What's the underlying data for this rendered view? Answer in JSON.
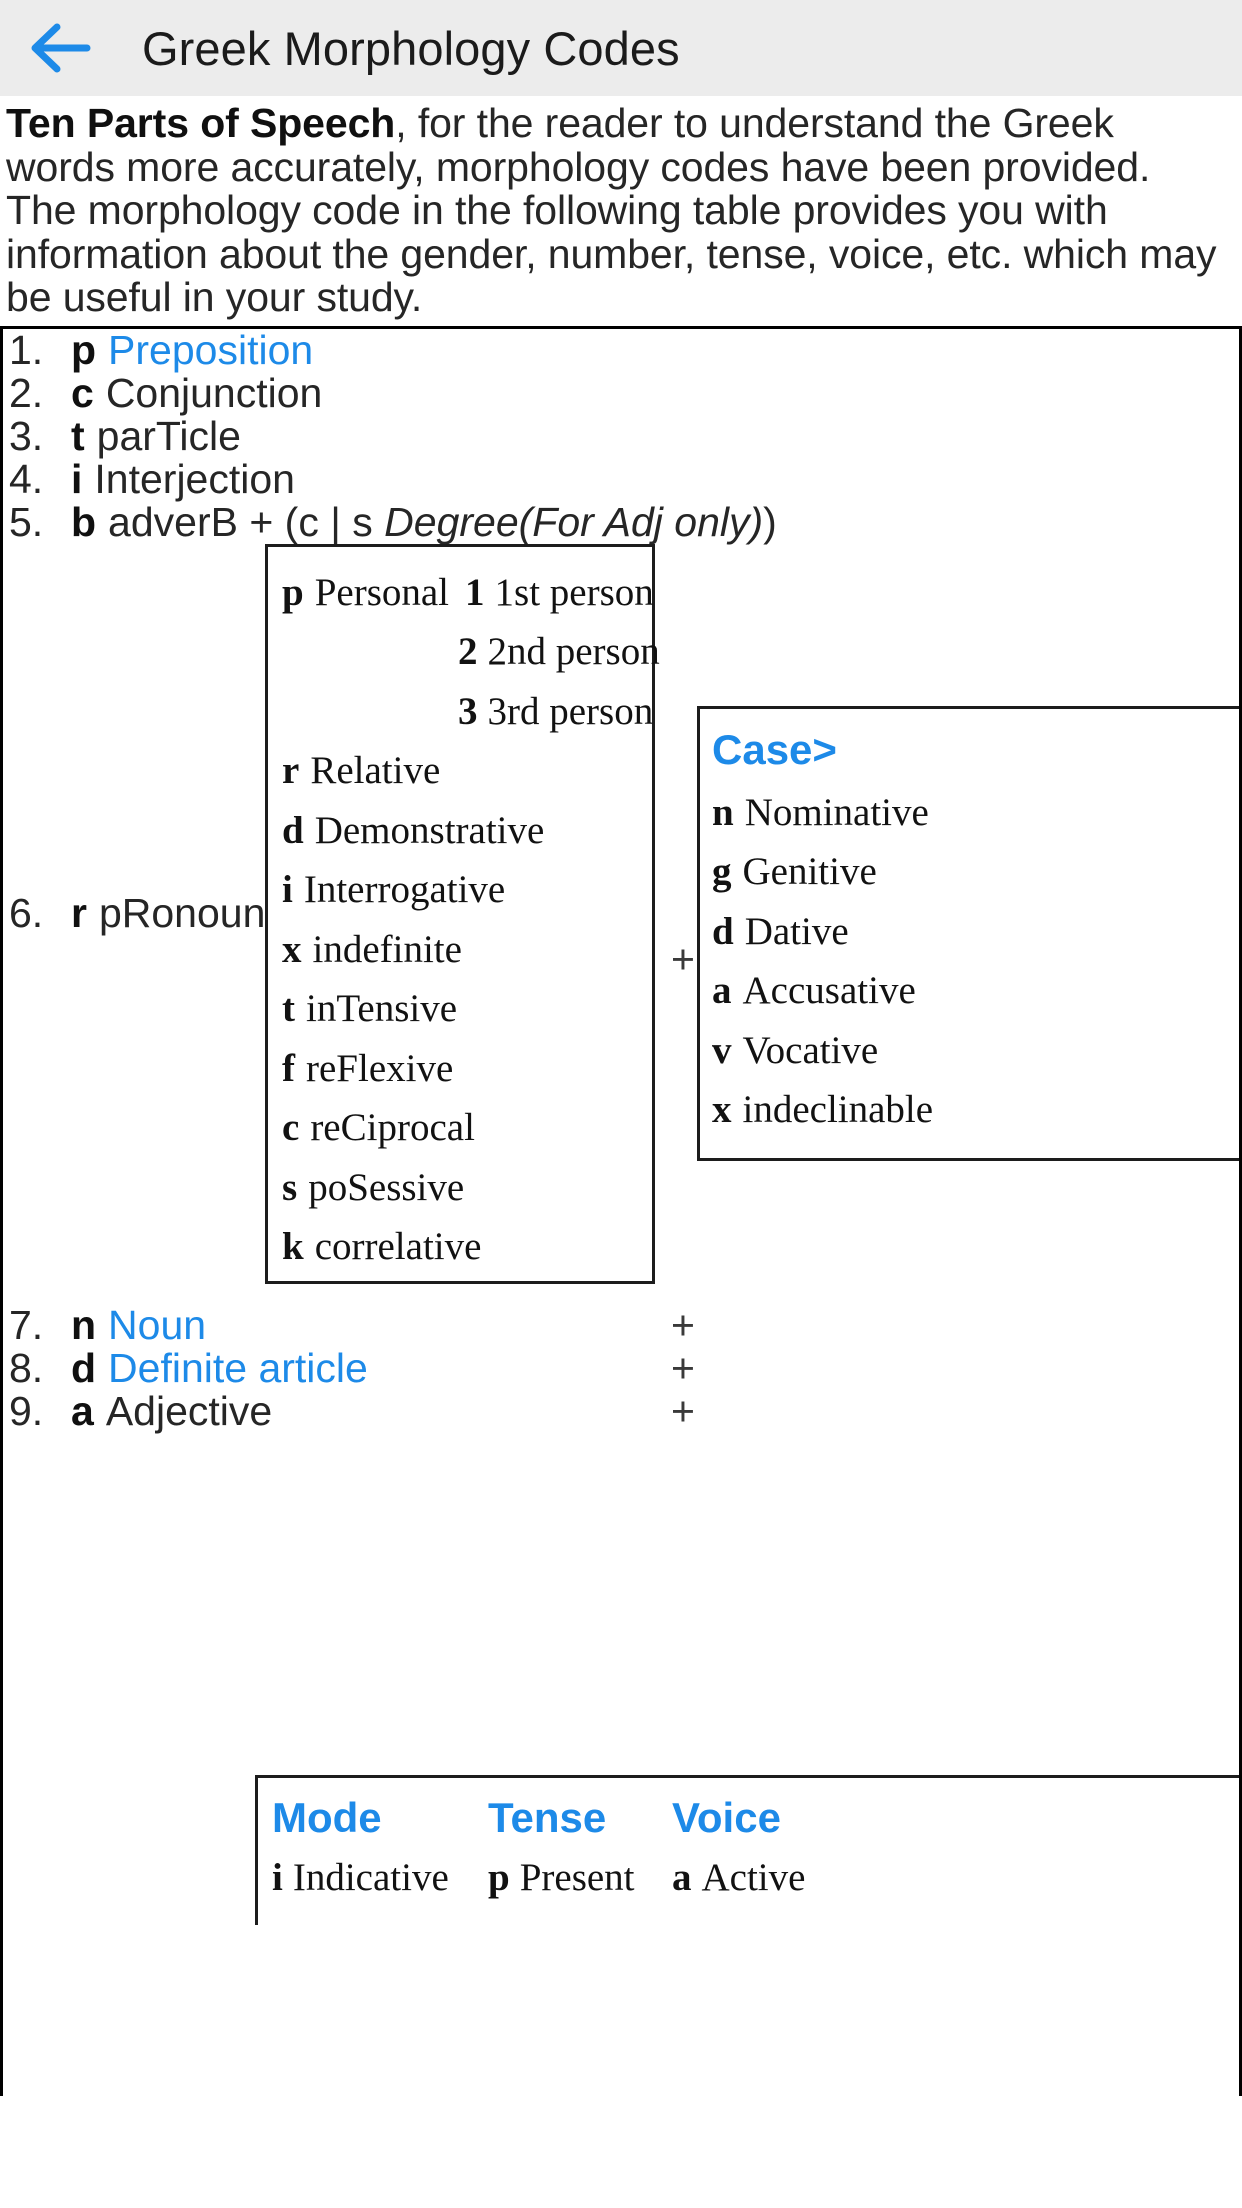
{
  "appbar": {
    "back_icon": "arrow-left-icon",
    "title": "Greek Morphology Codes",
    "accent": "#1d8ae8",
    "background": "#ececec"
  },
  "intro": {
    "lead": "Ten Parts of Speech",
    "body": ", for the reader to understand the Greek words more accurately, morphology codes have been provided. The morphology code in the following table provides you with information about the gender, number, tense, voice, etc. which may be useful in your study."
  },
  "parts_of_speech": [
    {
      "num": "1.",
      "code": "p",
      "label": "Preposition",
      "blue": true
    },
    {
      "num": "2.",
      "code": "c",
      "label": "Conjunction",
      "blue": false
    },
    {
      "num": "3.",
      "code": "t",
      "label": "parTicle",
      "blue": false
    },
    {
      "num": "4.",
      "code": "i",
      "label": "Interjection",
      "blue": false
    },
    {
      "num": "5.",
      "code": "b",
      "label_pre": "adverB + (c | s ",
      "label_italic": "Degree(For Adj only)",
      "label_post": ")",
      "blue": false
    },
    {
      "num": "6.",
      "code": "r",
      "label": "pRonoun",
      "plus": "+",
      "blue": false
    },
    {
      "num": "7.",
      "code": "n",
      "label": "Noun",
      "plus": "+",
      "blue": true
    },
    {
      "num": "8.",
      "code": "d",
      "label": "Definite article",
      "plus": "+",
      "blue": true
    },
    {
      "num": "9.",
      "code": "a",
      "label": "Adjective",
      "plus": "+",
      "blue": false
    }
  ],
  "pronoun_box": {
    "personal": {
      "code": "p",
      "label": "Personal"
    },
    "persons": [
      {
        "code": "1",
        "label": "1st person"
      },
      {
        "code": "2",
        "label": "2nd person"
      },
      {
        "code": "3",
        "label": "3rd person"
      }
    ],
    "types": [
      {
        "code": "r",
        "label": "Relative"
      },
      {
        "code": "d",
        "label": "Demonstrative"
      },
      {
        "code": "i",
        "label": "Interrogative"
      },
      {
        "code": "x",
        "label": "indefinite"
      },
      {
        "code": "t",
        "label": "inTensive"
      },
      {
        "code": "f",
        "label": "reFlexive"
      },
      {
        "code": "c",
        "label": "reCiprocal"
      },
      {
        "code": "s",
        "label": "poSessive"
      },
      {
        "code": "k",
        "label": "correlative"
      }
    ]
  },
  "case_box": {
    "title": "Case>",
    "plus": "+",
    "items": [
      {
        "code": "n",
        "label": "Nominative"
      },
      {
        "code": "g",
        "label": "Genitive"
      },
      {
        "code": "d",
        "label": "Dative"
      },
      {
        "code": "a",
        "label": "Accusative"
      },
      {
        "code": "v",
        "label": "Vocative"
      },
      {
        "code": "x",
        "label": "indeclinable"
      }
    ]
  },
  "mode_tense_voice": {
    "headers": [
      "Mode",
      "Tense",
      "Voice"
    ],
    "rows": [
      [
        {
          "code": "i",
          "label": "Indicative"
        },
        {
          "code": "p",
          "label": "Present"
        },
        {
          "code": "a",
          "label": "Active"
        }
      ]
    ]
  }
}
